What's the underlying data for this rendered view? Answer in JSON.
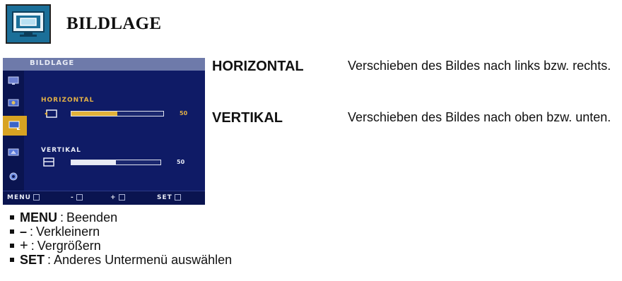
{
  "header": {
    "title": "BILDLAGE",
    "icon": "monitor-position-icon"
  },
  "osd": {
    "title": "BILDLAGE",
    "sidebar_icons": [
      "picture-icon",
      "color-icon",
      "position-icon",
      "setup-icon",
      "settings-icon"
    ],
    "active_icon_index": 2,
    "horizontal": {
      "label": "HORIZONTAL",
      "value": "50",
      "level": 0.5,
      "icon": "horizontal-position-icon"
    },
    "vertical": {
      "label": "VERTIKAL",
      "value": "50",
      "level": 0.5,
      "icon": "vertical-position-icon"
    },
    "bottom_bar": {
      "menu": "MENU",
      "minus": "-",
      "plus": "+",
      "set": "SET"
    },
    "colors": {
      "background": "#0f1b66",
      "title_bar": "#6e7aaa",
      "active_accent": "#d8a322",
      "text": "#e8ebf5"
    }
  },
  "definitions": [
    {
      "term": "HORIZONTAL",
      "description": "Verschieben des Bildes nach links bzw. rechts."
    },
    {
      "term": "VERTIKAL",
      "description": "Verschieben des Bildes nach oben bzw. unten."
    }
  ],
  "legend": [
    {
      "key": "MENU",
      "sep": ":",
      "text": "Beenden"
    },
    {
      "key": "–",
      "sep": ":",
      "text": "Verkleinern"
    },
    {
      "key": "+",
      "sep": ":",
      "text": "Vergrößern"
    },
    {
      "key": "SET",
      "sep": ":",
      "text": "Anderes Untermenü auswählen"
    }
  ]
}
